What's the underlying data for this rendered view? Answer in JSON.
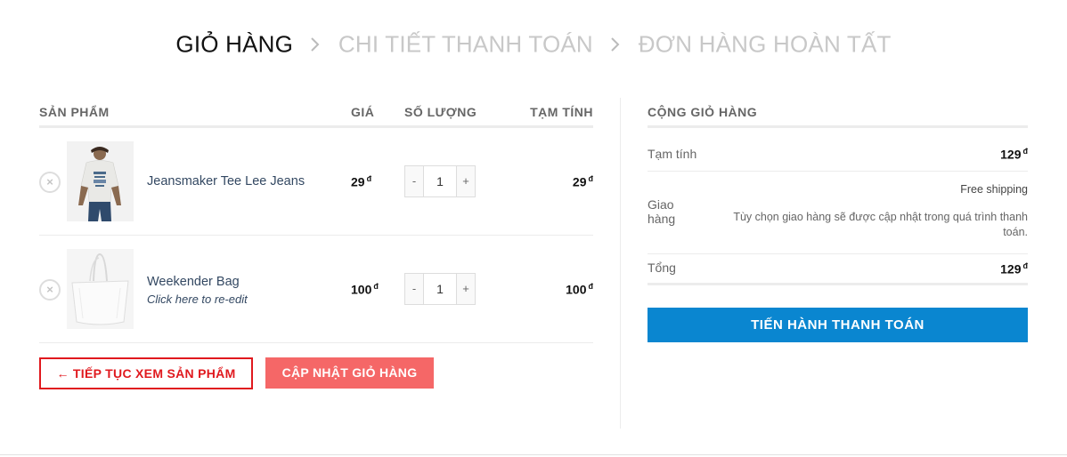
{
  "steps": {
    "cart": "GIỎ HÀNG",
    "checkout": "CHI TIẾT THANH TOÁN",
    "complete": "ĐƠN HÀNG HOÀN TẤT"
  },
  "table": {
    "headers": {
      "product": "SẢN PHẨM",
      "price": "GIÁ",
      "quantity": "SỐ LƯỢNG",
      "subtotal": "TẠM TÍNH"
    },
    "remove_symbol": "×",
    "items": [
      {
        "name": "Jeansmaker Tee Lee Jeans",
        "note": "",
        "price": "29",
        "currency": "đ",
        "quantity": "1",
        "subtotal": "29"
      },
      {
        "name": "Weekender Bag",
        "note": "Click here to re-edit",
        "price": "100",
        "currency": "đ",
        "quantity": "1",
        "subtotal": "100"
      }
    ],
    "qty_minus": "-",
    "qty_plus": "+"
  },
  "actions": {
    "continue": "← TIẾP TỤC XEM SẢN PHẨM",
    "update": "CẬP NHẬT GIỎ HÀNG"
  },
  "totals": {
    "title": "CỘNG GIỎ HÀNG",
    "subtotal_label": "Tạm tính",
    "subtotal_value": "129",
    "shipping_label": "Giao hàng",
    "shipping_method": "Free shipping",
    "shipping_note": "Tùy chọn giao hàng sẽ được cập nhật trong quá trình thanh toán.",
    "total_label": "Tổng",
    "total_value": "129",
    "currency": "đ",
    "checkout_button": "TIẾN HÀNH THANH TOÁN"
  },
  "colors": {
    "continue_border": "#e0191e",
    "update_bg": "#f56767",
    "checkout_bg": "#0a86d0"
  }
}
